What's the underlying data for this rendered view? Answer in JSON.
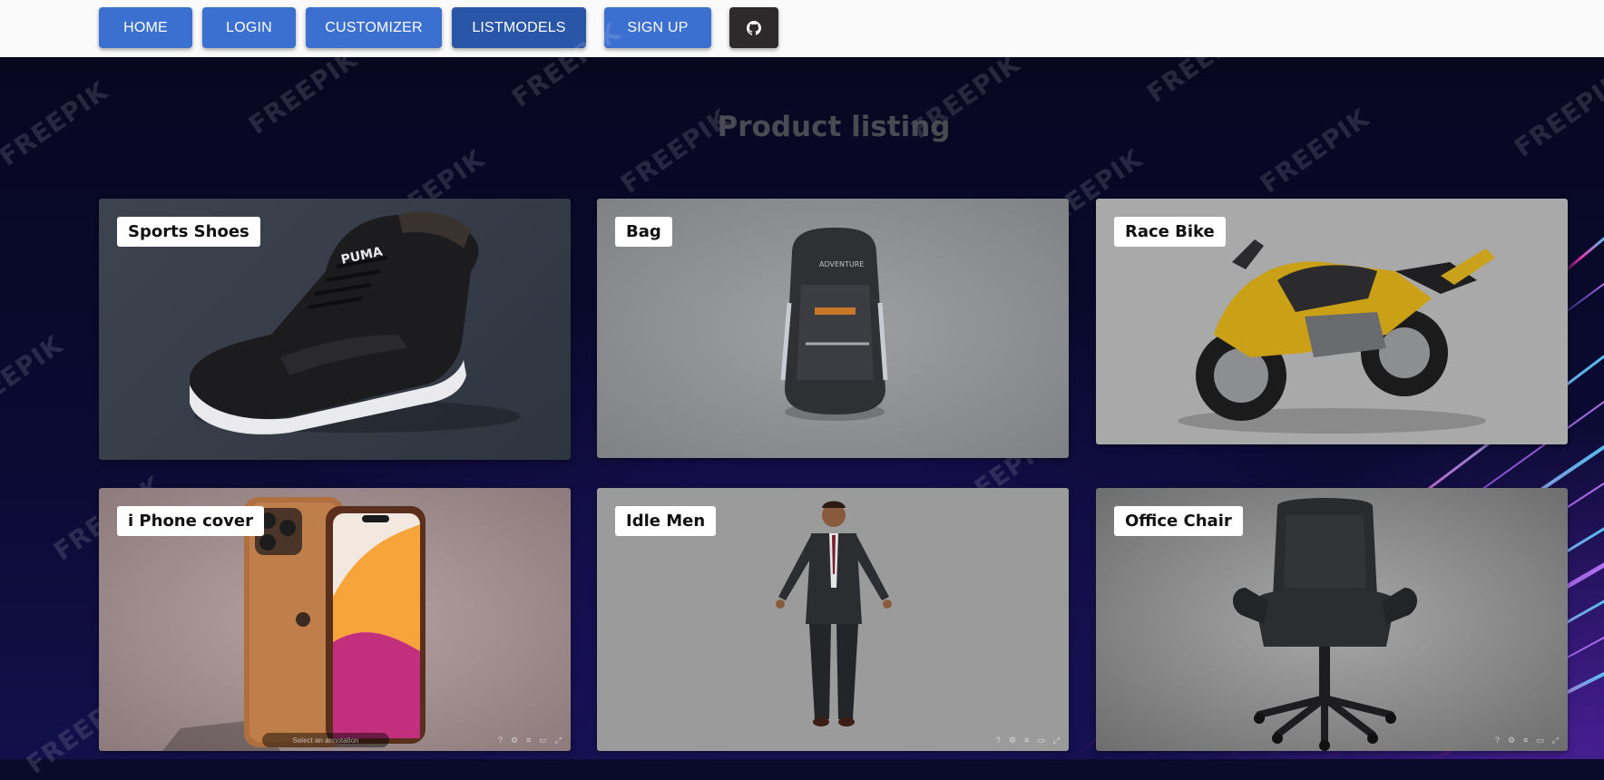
{
  "nav": {
    "home": "HOME",
    "login": "LOGIN",
    "customizer": "CUSTOMIZER",
    "listmodels": "LISTMODELS",
    "signup": "SIGN UP",
    "github_icon": "github-icon"
  },
  "page": {
    "title": "Product listing"
  },
  "watermark_text": "FREEPIK",
  "products": [
    {
      "label": "Sports Shoes"
    },
    {
      "label": "Bag"
    },
    {
      "label": "Race Bike"
    },
    {
      "label": "i Phone cover"
    },
    {
      "label": "Idle Men"
    },
    {
      "label": "Office Chair"
    }
  ],
  "viewer": {
    "annotation_placeholder": "Select an annotation"
  },
  "colors": {
    "nav_button": "#3b6fd0",
    "nav_button_active": "#2a56a8",
    "github_button": "#2c2a2b",
    "title": "#4a4a52"
  }
}
